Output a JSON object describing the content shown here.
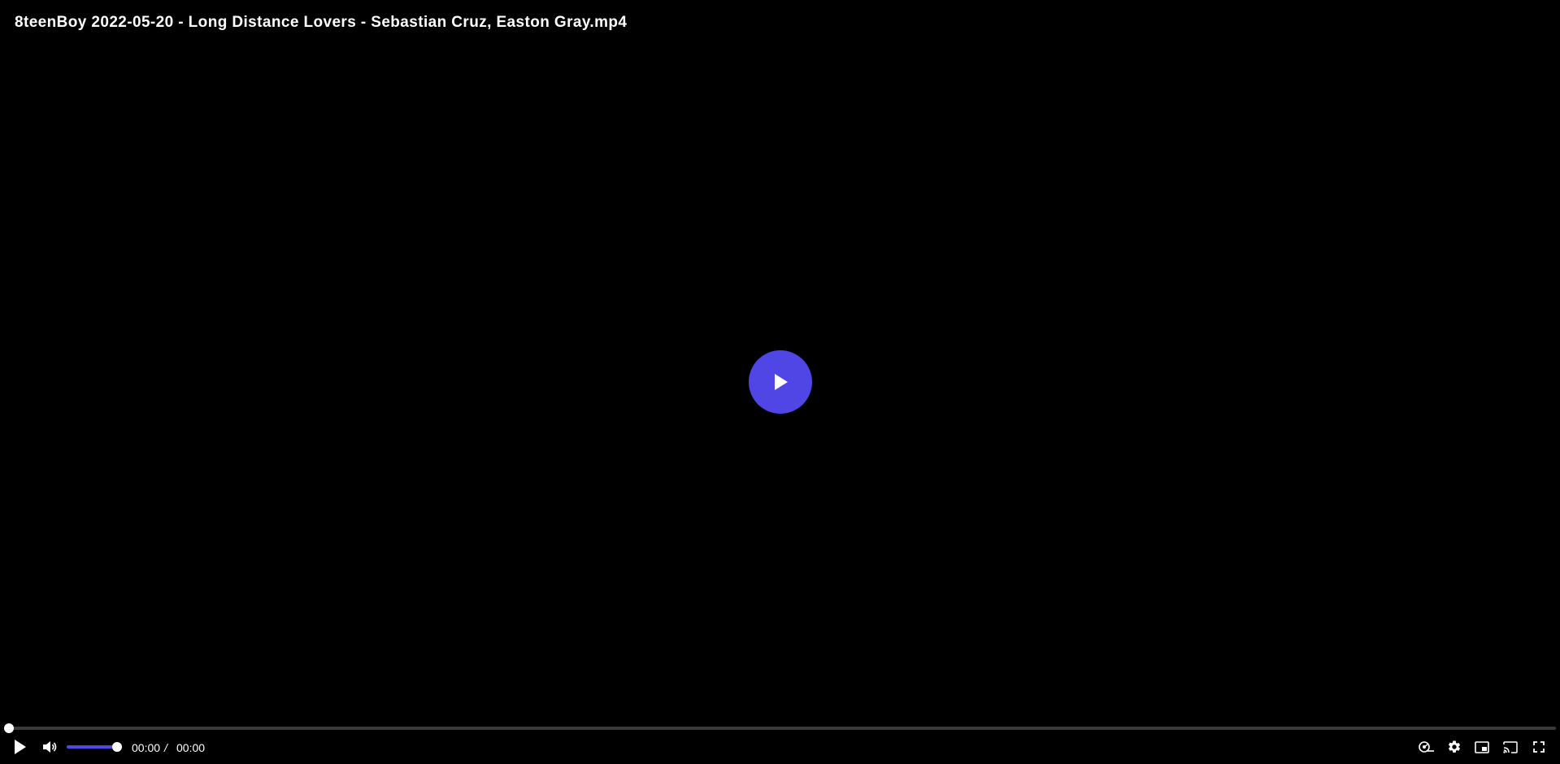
{
  "video": {
    "title": "8teenBoy 2022-05-20 - Long Distance Lovers - Sebastian Cruz, Easton Gray.mp4",
    "accent_color": "#4f46e5"
  },
  "playback": {
    "progress_fraction": 0,
    "current_time": "00:00",
    "time_separator": "/",
    "duration": "00:00"
  },
  "volume": {
    "level_fraction": 1.0
  },
  "controls": {
    "icons": [
      "play-icon",
      "volume-icon",
      "speed-icon",
      "settings-gear-icon",
      "picture-in-picture-icon",
      "cast-icon",
      "fullscreen-icon"
    ]
  }
}
